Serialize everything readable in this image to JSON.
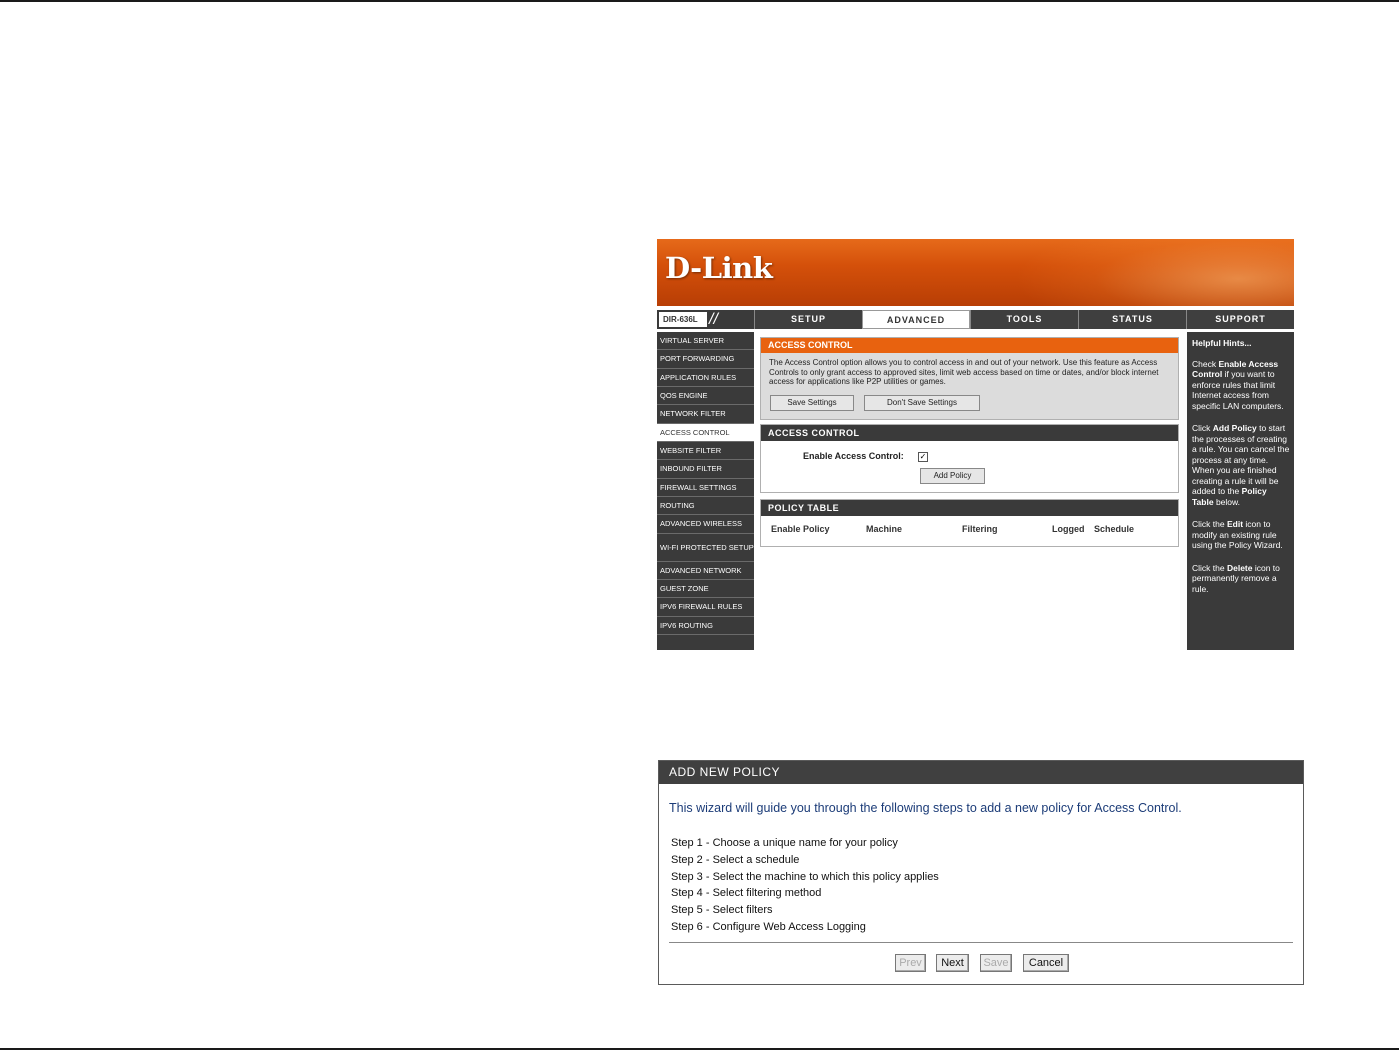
{
  "router": {
    "brand": "D-Link",
    "model": "DIR-636L",
    "tabs": [
      "SETUP",
      "ADVANCED",
      "TOOLS",
      "STATUS",
      "SUPPORT"
    ],
    "active_tab": "ADVANCED",
    "sidebar": [
      "VIRTUAL SERVER",
      "PORT FORWARDING",
      "APPLICATION RULES",
      "QOS ENGINE",
      "NETWORK FILTER",
      "ACCESS CONTROL",
      "WEBSITE FILTER",
      "INBOUND FILTER",
      "FIREWALL SETTINGS",
      "ROUTING",
      "ADVANCED WIRELESS",
      "WI-FI PROTECTED SETUP",
      "ADVANCED NETWORK",
      "GUEST ZONE",
      "IPV6 FIREWALL RULES",
      "IPV6 ROUTING"
    ],
    "active_sidebar": "ACCESS CONTROL",
    "section1": {
      "title": "ACCESS CONTROL",
      "description": "The Access Control option allows you to control access in and out of your network. Use this feature as Access Controls to only grant access to approved sites, limit web access based on time or dates, and/or block internet access for applications like P2P utilities or games.",
      "save_label": "Save Settings",
      "dont_save_label": "Don't Save Settings"
    },
    "section2": {
      "title": "ACCESS CONTROL",
      "enable_label": "Enable Access Control:",
      "enable_checked": true,
      "add_policy_label": "Add Policy"
    },
    "section3": {
      "title": "POLICY TABLE",
      "columns": [
        "Enable Policy",
        "Machine",
        "Filtering",
        "Logged",
        "Schedule"
      ]
    },
    "hints": {
      "title": "Helpful Hints...",
      "p1_pre": "Check ",
      "p1_bold": "Enable Access Control",
      "p1_post": " if you want to enforce rules that limit Internet access from specific LAN computers.",
      "p2_pre": "Click ",
      "p2_bold": "Add Policy",
      "p2_mid": " to start the processes of creating a rule. You can cancel the process at any time. When you are finished creating a rule it will be added to the ",
      "p2_bold2": "Policy Table",
      "p2_post": " below.",
      "p3_pre": "Click the ",
      "p3_bold": "Edit",
      "p3_post": " icon to modify an existing rule using the Policy Wizard.",
      "p4_pre": "Click the ",
      "p4_bold": "Delete",
      "p4_post": " icon to permanently remove a rule."
    }
  },
  "wizard": {
    "title": "ADD NEW POLICY",
    "intro": "This wizard will guide you through the following steps to add a new policy for Access Control.",
    "steps": [
      "Step 1 - Choose a unique name for your policy",
      "Step 2 - Select a schedule",
      "Step 3 - Select the machine to which this policy applies",
      "Step 4 - Select filtering method",
      "Step 5 - Select filters",
      "Step 6 - Configure Web Access Logging"
    ],
    "buttons": {
      "prev": "Prev",
      "next": "Next",
      "save": "Save",
      "cancel": "Cancel"
    }
  },
  "colors": {
    "accent_orange": "#e8620f",
    "dark_gray": "#3a3a3a",
    "intro_blue": "#1c3c78"
  }
}
